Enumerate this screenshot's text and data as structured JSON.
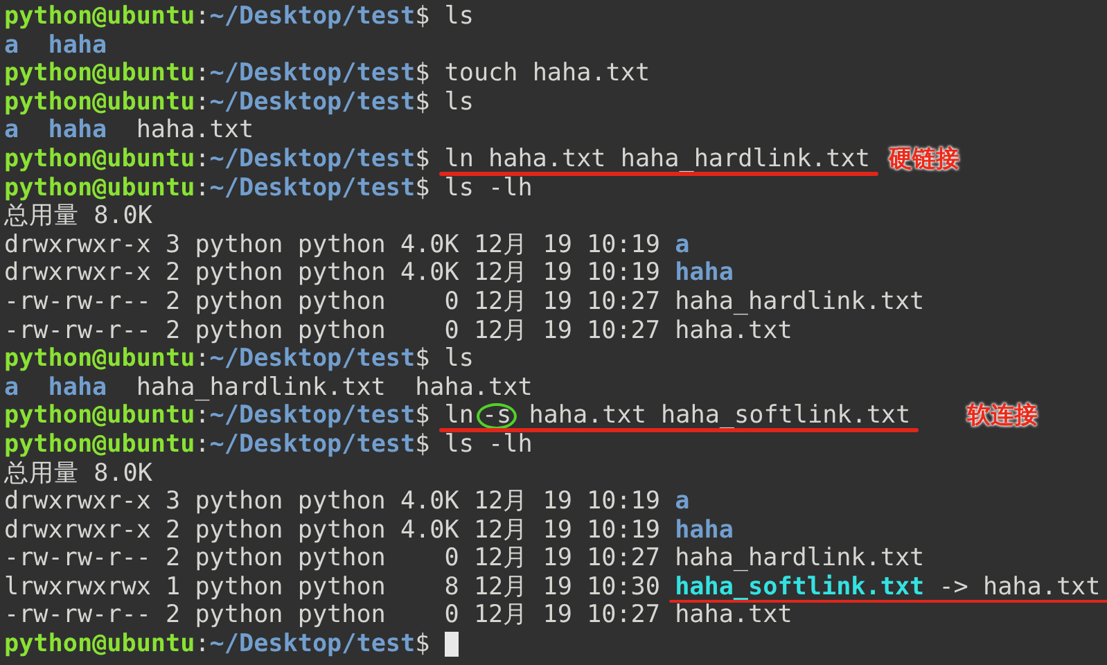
{
  "terminal": {
    "lines": [
      {
        "kind": "prompt",
        "user": "python@ubuntu",
        "host_sep": ":",
        "path": "~/Desktop/test",
        "symbol": "$",
        "command": [
          {
            "text": "ls"
          }
        ]
      },
      {
        "kind": "ls",
        "names": [
          {
            "kind": "dir",
            "text": "a"
          },
          {
            "kind": "dir",
            "text": "haha"
          }
        ]
      },
      {
        "kind": "prompt",
        "user": "python@ubuntu",
        "host_sep": ":",
        "path": "~/Desktop/test",
        "symbol": "$",
        "command": [
          {
            "text": "touch"
          },
          {
            "text": "haha.txt"
          }
        ]
      },
      {
        "kind": "prompt",
        "user": "python@ubuntu",
        "host_sep": ":",
        "path": "~/Desktop/test",
        "symbol": "$",
        "command": [
          {
            "text": "ls"
          }
        ]
      },
      {
        "kind": "ls",
        "names": [
          {
            "kind": "dir",
            "text": "a"
          },
          {
            "kind": "dir",
            "text": "haha"
          },
          {
            "kind": "file",
            "text": "haha.txt"
          }
        ]
      },
      {
        "kind": "prompt",
        "user": "python@ubuntu",
        "host_sep": ":",
        "path": "~/Desktop/test",
        "symbol": "$",
        "command": [
          {
            "text": "ln"
          },
          {
            "text": "haha.txt"
          },
          {
            "text": "haha_hardlink.txt"
          }
        ],
        "underlined": true,
        "note": "硬链接"
      },
      {
        "kind": "prompt",
        "user": "python@ubuntu",
        "host_sep": ":",
        "path": "~/Desktop/test",
        "symbol": "$",
        "command": [
          {
            "text": "ls"
          },
          {
            "text": "-lh"
          }
        ]
      },
      {
        "kind": "total",
        "text": "总用量 8.0K"
      },
      {
        "kind": "listing",
        "info": "drwxrwxr-x 3 python python 4.0K 12月 19 10:19",
        "names": [
          {
            "kind": "dir",
            "text": "a"
          }
        ]
      },
      {
        "kind": "listing",
        "info": "drwxrwxr-x 2 python python 4.0K 12月 19 10:19",
        "names": [
          {
            "kind": "dir",
            "text": "haha"
          }
        ]
      },
      {
        "kind": "listing",
        "info": "-rw-rw-r-- 2 python python    0 12月 19 10:27",
        "names": [
          {
            "kind": "file",
            "text": "haha_hardlink.txt"
          }
        ]
      },
      {
        "kind": "listing",
        "info": "-rw-rw-r-- 2 python python    0 12月 19 10:27",
        "names": [
          {
            "kind": "file",
            "text": "haha.txt"
          }
        ]
      },
      {
        "kind": "prompt",
        "user": "python@ubuntu",
        "host_sep": ":",
        "path": "~/Desktop/test",
        "symbol": "$",
        "command": [
          {
            "text": "ls"
          }
        ]
      },
      {
        "kind": "ls",
        "names": [
          {
            "kind": "dir",
            "text": "a"
          },
          {
            "kind": "dir",
            "text": "haha"
          },
          {
            "kind": "file",
            "text": "haha_hardlink.txt"
          },
          {
            "kind": "file",
            "text": "haha.txt"
          }
        ]
      },
      {
        "kind": "prompt",
        "user": "python@ubuntu",
        "host_sep": ":",
        "path": "~/Desktop/test",
        "symbol": "$",
        "command": [
          {
            "text": "ln"
          },
          {
            "text": "-s",
            "circled": true
          },
          {
            "text": "haha.txt"
          },
          {
            "text": "haha_softlink.txt"
          }
        ],
        "underlined": true,
        "note": "软连接"
      },
      {
        "kind": "prompt",
        "user": "python@ubuntu",
        "host_sep": ":",
        "path": "~/Desktop/test",
        "symbol": "$",
        "command": [
          {
            "text": "ls"
          },
          {
            "text": "-lh"
          }
        ]
      },
      {
        "kind": "total",
        "text": "总用量 8.0K"
      },
      {
        "kind": "listing",
        "info": "drwxrwxr-x 3 python python 4.0K 12月 19 10:19",
        "names": [
          {
            "kind": "dir",
            "text": "a"
          }
        ]
      },
      {
        "kind": "listing",
        "info": "drwxrwxr-x 2 python python 4.0K 12月 19 10:19",
        "names": [
          {
            "kind": "dir",
            "text": "haha"
          }
        ]
      },
      {
        "kind": "listing",
        "info": "-rw-rw-r-- 2 python python    0 12月 19 10:27",
        "names": [
          {
            "kind": "file",
            "text": "haha_hardlink.txt"
          }
        ]
      },
      {
        "kind": "listing",
        "info": "lrwxrwxrwx 1 python python    8 12月 19 10:30",
        "names": [
          {
            "kind": "link",
            "text": "haha_softlink.txt"
          },
          {
            "kind": "file",
            "text": "->"
          },
          {
            "kind": "file",
            "text": "haha.txt"
          }
        ],
        "underlined": true
      },
      {
        "kind": "listing",
        "info": "-rw-rw-r-- 2 python python    0 12月 19 10:27",
        "names": [
          {
            "kind": "file",
            "text": "haha.txt"
          }
        ]
      },
      {
        "kind": "prompt",
        "user": "python@ubuntu",
        "host_sep": ":",
        "path": "~/Desktop/test",
        "symbol": "$",
        "cursor": true
      }
    ]
  }
}
